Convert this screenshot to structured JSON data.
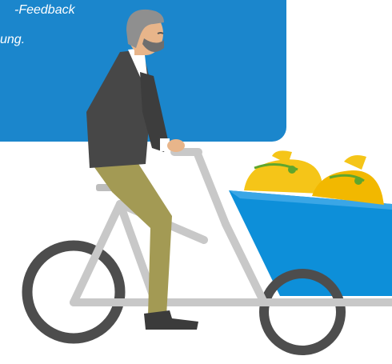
{
  "banner": {
    "line1": "-Feedback",
    "line2": "ung.",
    "color": "#1b86cc"
  },
  "illustration": {
    "icon": "cargo-bike-rider-illustration",
    "colors": {
      "wheel": "#4d4d4d",
      "frame": "#c8c8c8",
      "box": "#0d8fd9",
      "cargo": "#f5c518",
      "jacket": "#474747",
      "pants": "#a39a54",
      "skin": "#e8b58a",
      "hair": "#8f8f8f"
    }
  }
}
